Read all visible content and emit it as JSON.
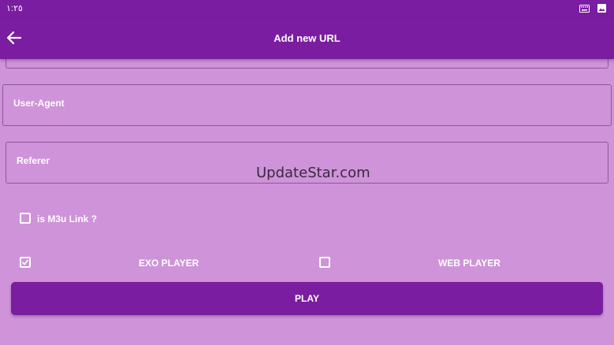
{
  "status_bar": {
    "time": "١:٢٥",
    "icons": [
      "keyboard-icon",
      "image-icon"
    ]
  },
  "app_bar": {
    "title": "Add new URL",
    "back_icon": "arrow-left-icon"
  },
  "fields": {
    "user_agent": {
      "label": "User-Agent",
      "value": ""
    },
    "referer": {
      "label": "Referer",
      "value": ""
    }
  },
  "watermark": "UpdateStar.com",
  "options": {
    "is_m3u": {
      "label": "is M3u Link ?",
      "checked": false
    },
    "exo_player": {
      "label": "EXO PLAYER",
      "checked": true
    },
    "web_player": {
      "label": "WEB PLAYER",
      "checked": false
    }
  },
  "play_button": {
    "label": "PLAY"
  },
  "colors": {
    "primary": "#7a1da0",
    "background": "#cf93d9",
    "text": "#ffffff"
  }
}
